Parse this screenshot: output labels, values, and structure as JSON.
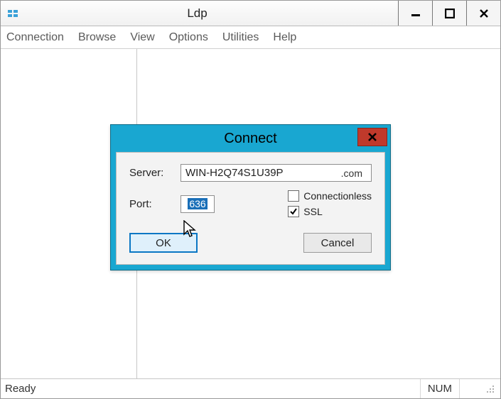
{
  "window": {
    "title": "Ldp"
  },
  "menu": {
    "items": [
      "Connection",
      "Browse",
      "View",
      "Options",
      "Utilities",
      "Help"
    ]
  },
  "status": {
    "left": "Ready",
    "num": "NUM"
  },
  "dialog": {
    "title": "Connect",
    "server_label": "Server:",
    "server_value": "WIN-H2Q74S1U39P",
    "server_suffix": ".com",
    "port_label": "Port:",
    "port_value": "636",
    "connectionless_label": "Connectionless",
    "connectionless_checked": false,
    "ssl_label": "SSL",
    "ssl_checked": true,
    "ok_label": "OK",
    "cancel_label": "Cancel"
  }
}
